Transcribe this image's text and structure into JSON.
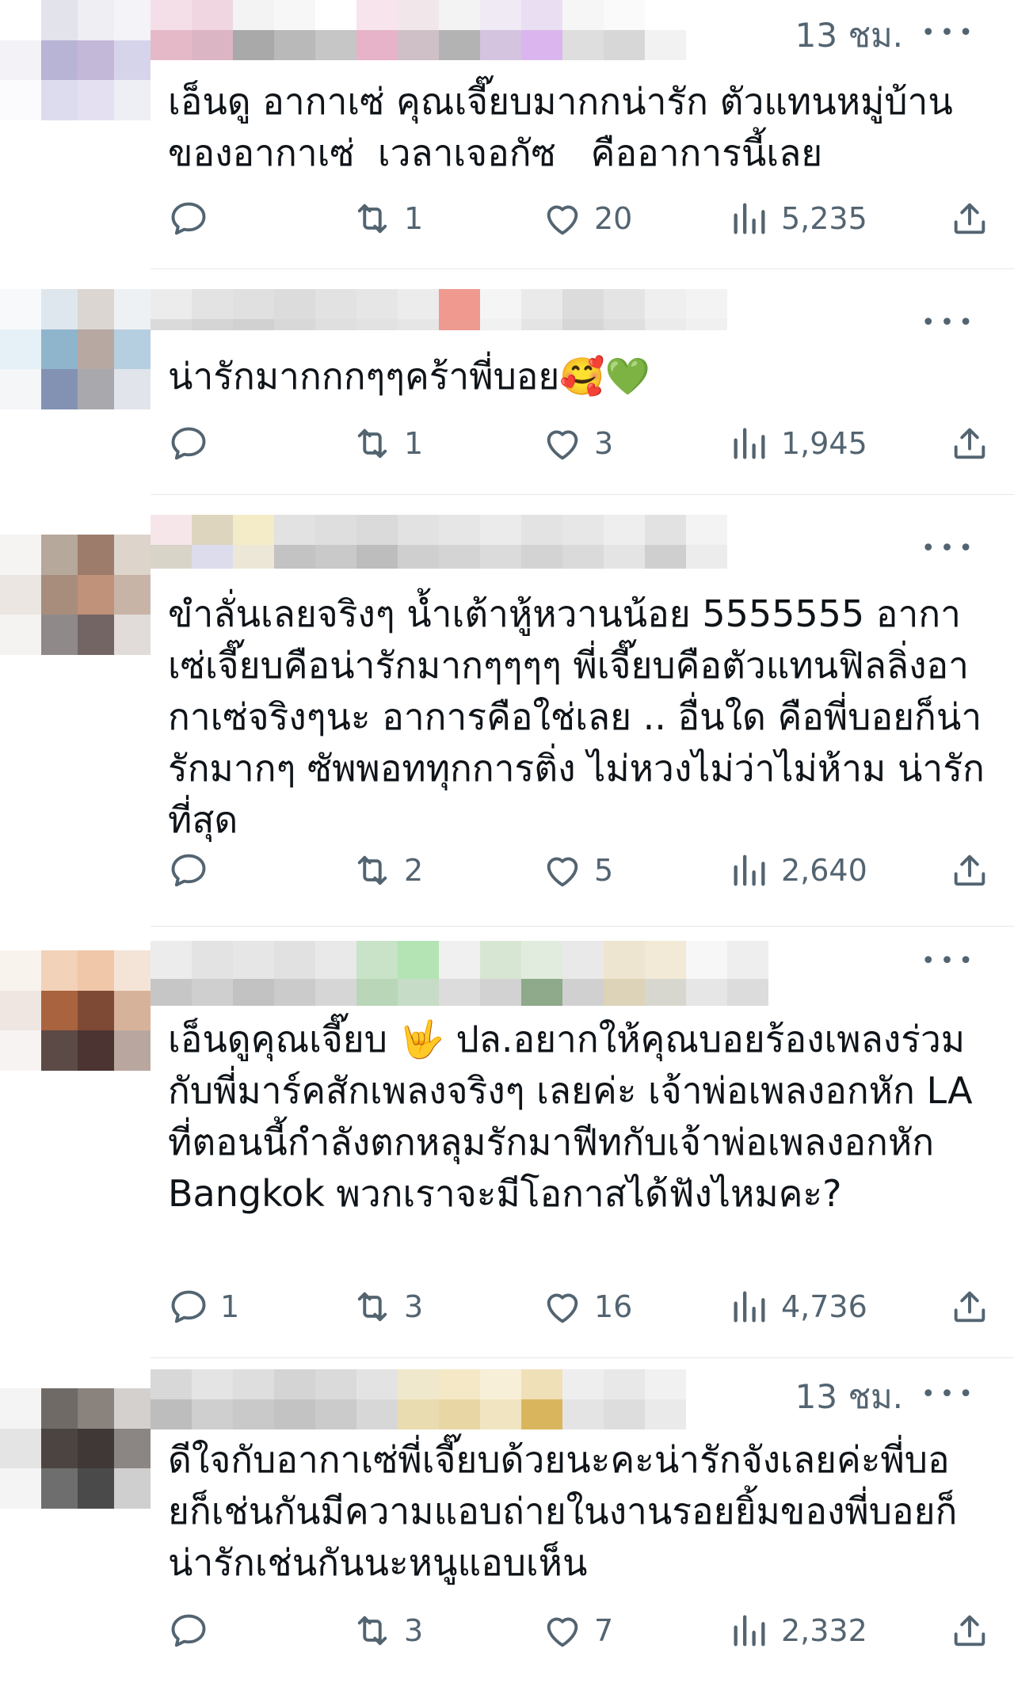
{
  "replies": [
    {
      "timestamp": "13 ชม.",
      "text": "เอ็นดู อากาเซ่ คุณเจี๊ยบมากกน่ารัก ตัวแทนหมู่บ้านของอากาเซ่  เวลาเจอกัซ   คืออาการนี้เลย",
      "replies": "",
      "retweets": "1",
      "likes": "20",
      "views": "5,235"
    },
    {
      "timestamp": "",
      "text": "น่ารักมากกกๆๆคร้าพี่บอย🥰💚",
      "replies": "",
      "retweets": "1",
      "likes": "3",
      "views": "1,945"
    },
    {
      "timestamp": "",
      "text": "ขำลั่นเลยจริงๆ น้ำเต้าหู้หวานน้อย 5555555 อากาเซ่เจี๊ยบคือน่ารักมากๆๆๆๆ พี่เจี๊ยบคือตัวแทนฟิลลิ่งอากาเซ่จริงๆนะ อาการคือใช่เลย .. อื่นใด คือพี่บอยก็น่ารักมากๆ ซัพพอททุกการติ่ง ไม่หวงไม่ว่าไม่ห้าม น่ารักที่สุด",
      "replies": "",
      "retweets": "2",
      "likes": "5",
      "views": "2,640"
    },
    {
      "timestamp": "",
      "text": "เอ็นดูคุณเจี๊ยบ 🤟 ปล.อยากให้คุณบอยร้องเพลงร่วมกับพี่มาร์คสักเพลงจริงๆ เลยค่ะ เจ้าพ่อเพลงอกหัก LA ที่ตอนนี้กำลังตกหลุมรักมาฟีทกับเจ้าพ่อเพลงอกหัก Bangkok พวกเราจะมีโอกาสได้ฟังไหมคะ?",
      "replies": "1",
      "retweets": "3",
      "likes": "16",
      "views": "4,736"
    },
    {
      "timestamp": "13 ชม.",
      "text": "ดีใจกับอากาเซ่พี่เจี๊ยบด้วยนะคะน่ารักจังเลยค่ะพี่บอยก็เช่นกันมีความแอบถ่ายในงานรอยยิ้มของพี่บอยก็น่ารักเช่นกันนะหนูแอบเห็น",
      "replies": "",
      "retweets": "3",
      "likes": "7",
      "views": "2,332"
    }
  ],
  "colors": {
    "text": "#0f1419",
    "muted": "#536471",
    "separator": "#e6e8ea"
  },
  "icons": [
    "reply-icon",
    "retweet-icon",
    "heart-icon",
    "views-icon",
    "share-icon",
    "more-icon"
  ]
}
